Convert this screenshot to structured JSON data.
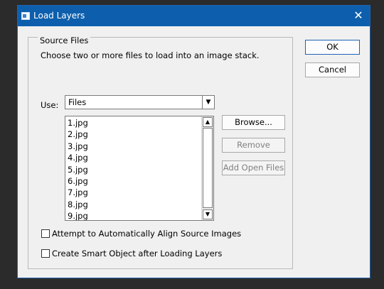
{
  "dialog": {
    "title": "Load Layers",
    "close_glyph": "✕",
    "source_files": {
      "legend": "Source Files",
      "hint": "Choose two or more files to load into an image stack.",
      "use_label": "Use:",
      "use_value": "Files",
      "files": [
        "1.jpg",
        "2.jpg",
        "3.jpg",
        "4.jpg",
        "5.jpg",
        "6.jpg",
        "7.jpg",
        "8.jpg",
        "9.jpg"
      ],
      "browse_label": "Browse...",
      "remove_label": "Remove",
      "add_open_files_label": "Add Open Files",
      "auto_align_label": "Attempt to Automatically Align Source Images",
      "auto_align_checked": false,
      "smart_object_label": "Create Smart Object after Loading Layers",
      "smart_object_checked": false
    },
    "ok_label": "OK",
    "cancel_label": "Cancel"
  },
  "icons": {
    "app": "photoshop-dialog-icon",
    "close": "close-icon",
    "dropdown": "chevron-down-icon",
    "scroll_up": "scroll-up-arrow-icon",
    "scroll_down": "scroll-down-arrow-icon"
  },
  "colors": {
    "title_bar": "#0d5fad",
    "dialog_bg": "#f0f0f0",
    "backdrop": "#2b2b2b"
  }
}
